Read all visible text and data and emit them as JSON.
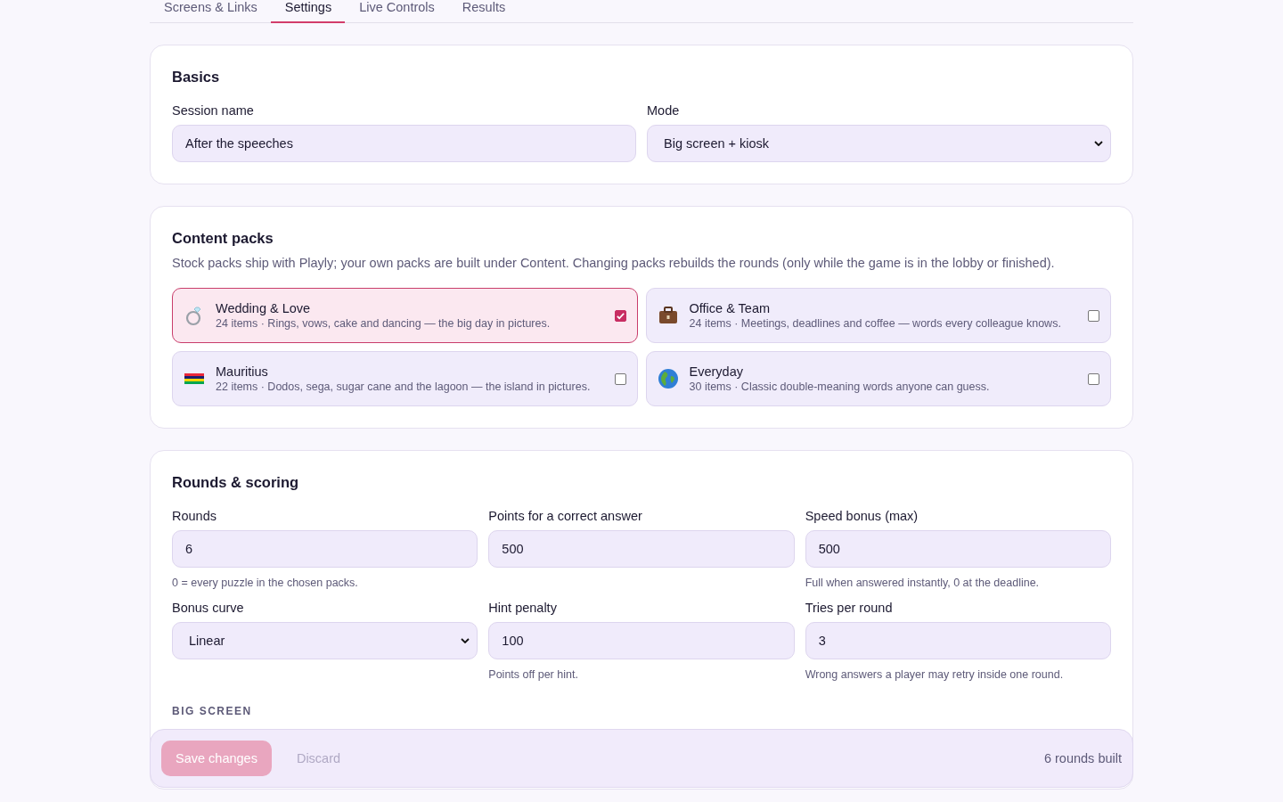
{
  "tabs": [
    {
      "label": "Screens & Links",
      "selected": false
    },
    {
      "label": "Settings",
      "selected": true
    },
    {
      "label": "Live Controls",
      "selected": false
    },
    {
      "label": "Results",
      "selected": false
    }
  ],
  "basics": {
    "title": "Basics",
    "session_name": {
      "label": "Session name",
      "value": "After the speeches"
    },
    "mode": {
      "label": "Mode",
      "value": "Big screen + kiosk"
    }
  },
  "content_packs": {
    "title": "Content packs",
    "description": "Stock packs ship with Playly; your own packs are built under Content. Changing packs rebuilds the rounds (only while the game is in the lobby or finished).",
    "packs": [
      {
        "name": "Wedding & Love",
        "details": "24 items · Rings, vows, cake and dancing — the big day in pictures.",
        "checked": true
      },
      {
        "name": "Office & Team",
        "details": "24 items · Meetings, deadlines and coffee — words every colleague knows.",
        "checked": false
      },
      {
        "name": "Mauritius",
        "details": "22 items · Dodos, sega, sugar cane and the lagoon — the island in pictures.",
        "checked": false
      },
      {
        "name": "Everyday",
        "details": "30 items · Classic double-meaning words anyone can guess.",
        "checked": false
      }
    ]
  },
  "rounds_scoring": {
    "title": "Rounds & scoring",
    "fields": [
      {
        "kind": "input",
        "label": "Rounds",
        "value": "6",
        "hint": "0 = every puzzle in the chosen packs."
      },
      {
        "kind": "input",
        "label": "Points for a correct answer",
        "value": "500"
      },
      {
        "kind": "input",
        "label": "Speed bonus (max)",
        "value": "500",
        "hint": "Full when answered instantly, 0 at the deadline."
      },
      {
        "kind": "select",
        "label": "Bonus curve",
        "value": "Linear"
      },
      {
        "kind": "input",
        "label": "Hint penalty",
        "value": "100",
        "hint": "Points off per hint."
      },
      {
        "kind": "input",
        "label": "Tries per round",
        "value": "3",
        "hint": "Wrong answers a player may retry inside one round."
      }
    ],
    "subheading": "BIG SCREEN"
  },
  "save_bar": {
    "save": {
      "label": "Save changes",
      "disabled": true
    },
    "discard": {
      "label": "Discard",
      "disabled": true
    },
    "status": "6 rounds built"
  }
}
